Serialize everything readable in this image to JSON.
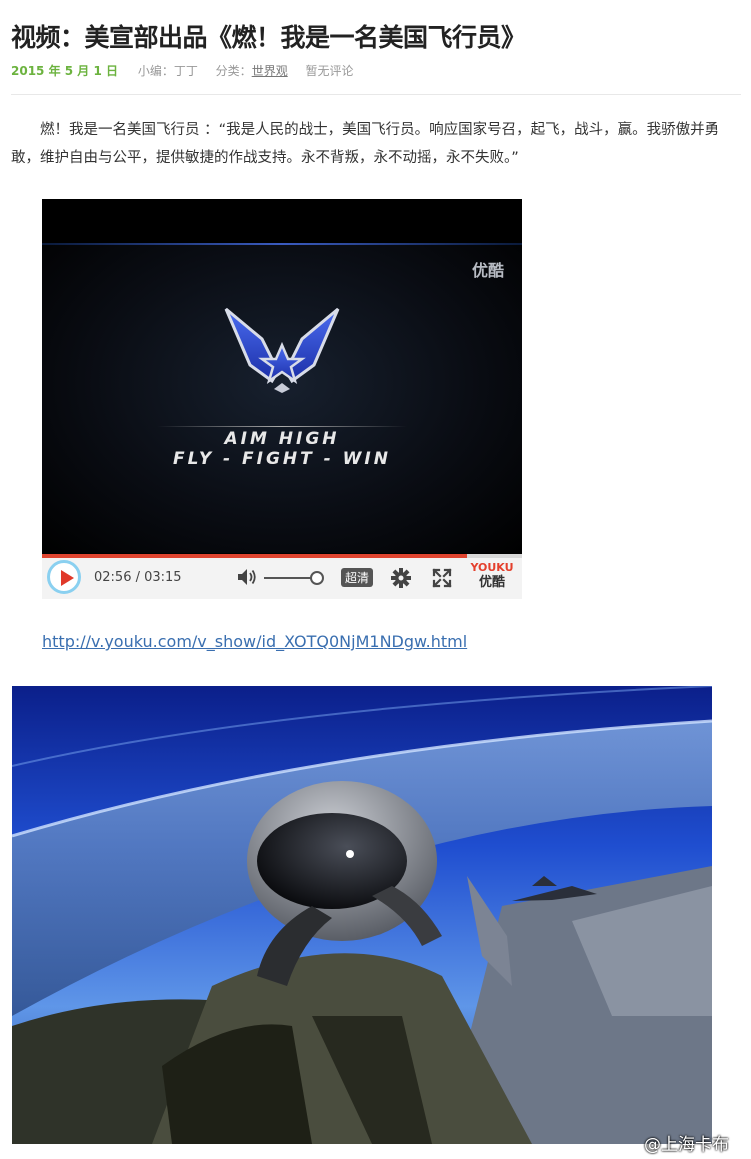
{
  "article": {
    "title": "视频：美宣部出品《燃！我是一名美国飞行员》",
    "date": "2015 年 5 月 1 日",
    "editor_label": "小编：丁丁",
    "category_prefix": "分类：",
    "category_link": "世界观",
    "comments": "暂无评论",
    "intro": "燃！我是一名美国飞行员 ：“我是人民的战士，美国飞行员。响应国家号召，起飞，战斗，赢。我骄傲并勇敢，维护自由与公平，提供敏捷的作战支持。永不背叛，永不动摇，永不失败。”"
  },
  "video": {
    "watermark": "优酷",
    "motto_line1": "AIM HIGH",
    "motto_line2": "FLY - FIGHT - WIN",
    "current_time": "02:56",
    "duration": "03:15",
    "time_display": "02:56 / 03:15",
    "progress": 0.886,
    "volume": 0.85,
    "quality_label": "超清",
    "logo_en": "YOUKU",
    "logo_cn": "优酷",
    "play_icon": "play-icon",
    "volume_icon": "volume-icon",
    "settings_icon": "gear-icon",
    "fullscreen_icon": "fullscreen-icon",
    "colors": {
      "progress": "#e0442f",
      "play": "#e0392a",
      "play_ring": "#8ad0f0"
    }
  },
  "video_link": "http://v.youku.com/v_show/id_XOTQ0NjM1NDgw.html",
  "photo": {
    "credit": "@上海卡布"
  },
  "colors": {
    "date_green": "#6cb33f",
    "link_blue": "#3a6fb0"
  }
}
